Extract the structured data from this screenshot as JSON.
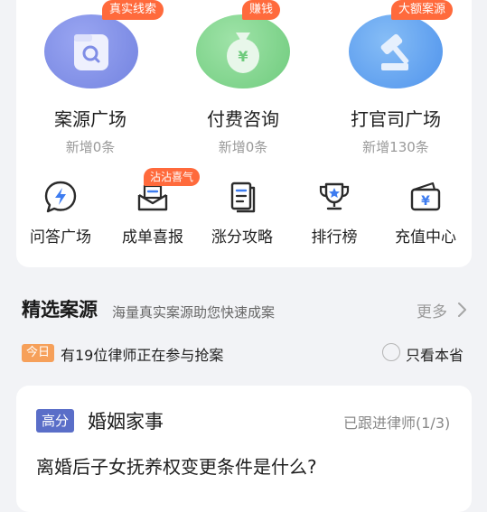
{
  "top_features": [
    {
      "title": "案源广场",
      "sub": "新增0条",
      "badge": "真实线索",
      "icon": "magnifier-card-icon",
      "color": "#7f8de6"
    },
    {
      "title": "付费咨询",
      "sub": "新增0条",
      "badge": "赚钱",
      "icon": "money-bag-icon",
      "color": "#7ed48a"
    },
    {
      "title": "打官司广场",
      "sub": "新增130条",
      "badge": "大额案源",
      "icon": "gavel-icon",
      "color": "#5a9ff0"
    }
  ],
  "small_features": [
    {
      "label": "问答广场",
      "icon": "lightning-chat-icon"
    },
    {
      "label": "成单喜报",
      "icon": "mailbox-icon",
      "badge": "沾沾喜气"
    },
    {
      "label": "涨分攻略",
      "icon": "document-icon"
    },
    {
      "label": "排行榜",
      "icon": "trophy-icon"
    },
    {
      "label": "充值中心",
      "icon": "wallet-icon"
    }
  ],
  "section": {
    "title": "精选案源",
    "subtitle": "海量真实案源助您快速成案",
    "more": "更多"
  },
  "today": {
    "badge": "今日",
    "text": "有19位律师正在参与抢案",
    "filter_label": "只看本省"
  },
  "case": {
    "tag": "高分",
    "category": "婚姻家事",
    "follow": "已跟进律师(1/3)",
    "question": "离婚后子女抚养权变更条件是什么?"
  },
  "colors": {
    "accent_orange": "#ff6a3c",
    "tag_blue": "#5a6ec8",
    "today_orange": "#f6a05a"
  }
}
